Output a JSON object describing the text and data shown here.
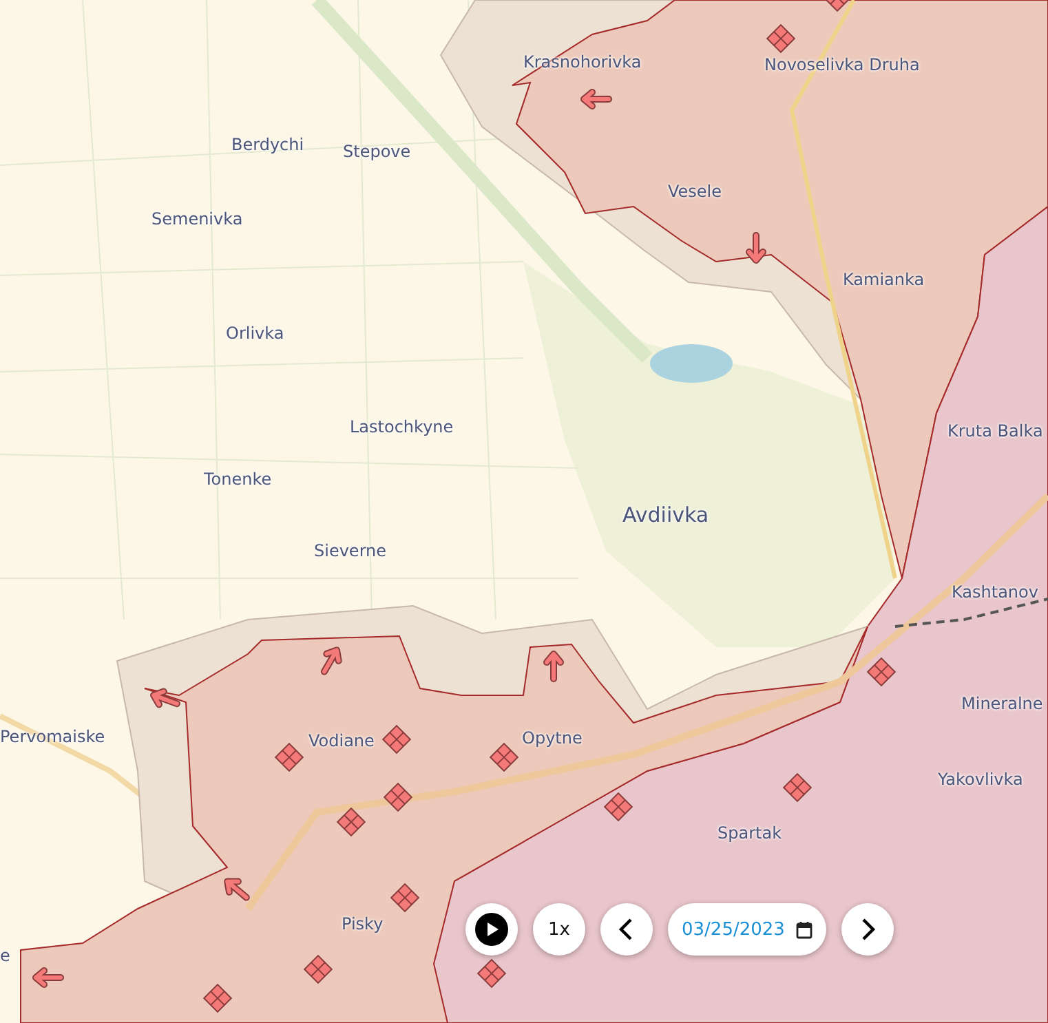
{
  "map": {
    "places": [
      {
        "name": "Krasnohorivka",
        "kind": "town"
      },
      {
        "name": "Novoselivka Druha",
        "kind": "town"
      },
      {
        "name": "Berdychi",
        "kind": "town"
      },
      {
        "name": "Stepove",
        "kind": "town"
      },
      {
        "name": "Vesele",
        "kind": "town"
      },
      {
        "name": "Semenivka",
        "kind": "town"
      },
      {
        "name": "Kamianka",
        "kind": "town"
      },
      {
        "name": "Orlivka",
        "kind": "town"
      },
      {
        "name": "Lastochkyne",
        "kind": "town"
      },
      {
        "name": "Kruta Balka",
        "kind": "town"
      },
      {
        "name": "Tonenke",
        "kind": "town"
      },
      {
        "name": "Avdiivka",
        "kind": "city"
      },
      {
        "name": "Sieverne",
        "kind": "town"
      },
      {
        "name": "Kashtanov",
        "kind": "town"
      },
      {
        "name": "Pervomaiske",
        "kind": "town"
      },
      {
        "name": "Mineralne",
        "kind": "town"
      },
      {
        "name": "Vodiane",
        "kind": "town"
      },
      {
        "name": "Opytne",
        "kind": "town"
      },
      {
        "name": "Yakovlivka",
        "kind": "town"
      },
      {
        "name": "Spartak",
        "kind": "town"
      },
      {
        "name": "Pisky",
        "kind": "town"
      },
      {
        "name": "e",
        "kind": "town"
      }
    ]
  },
  "player": {
    "speed": "1x",
    "date": "03/25/2023"
  }
}
